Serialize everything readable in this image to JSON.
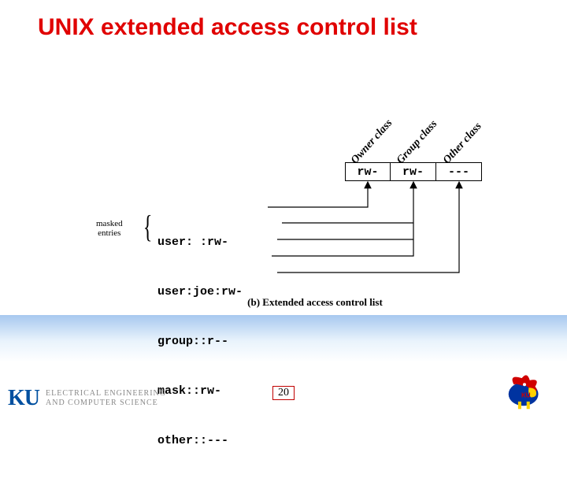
{
  "title": "UNIX extended access control list",
  "classes": {
    "owner": "Owner class",
    "group": "Group class",
    "other": "Other class"
  },
  "perm_boxes": {
    "owner": "rw-",
    "group": "rw-",
    "other": "---"
  },
  "acl": {
    "user": "user: :rw-",
    "user_joe": "user:joe:rw-",
    "group": "group::r--",
    "mask": "mask::rw-",
    "other": "other::---"
  },
  "masked_label_line1": "masked",
  "masked_label_line2": "entries",
  "caption": "(b) Extended access control list",
  "page_number": "20",
  "footer": {
    "ku": "KU",
    "dept_line1": "ELECTRICAL ENGINEERING",
    "dept_line2": "AND COMPUTER SCIENCE"
  }
}
